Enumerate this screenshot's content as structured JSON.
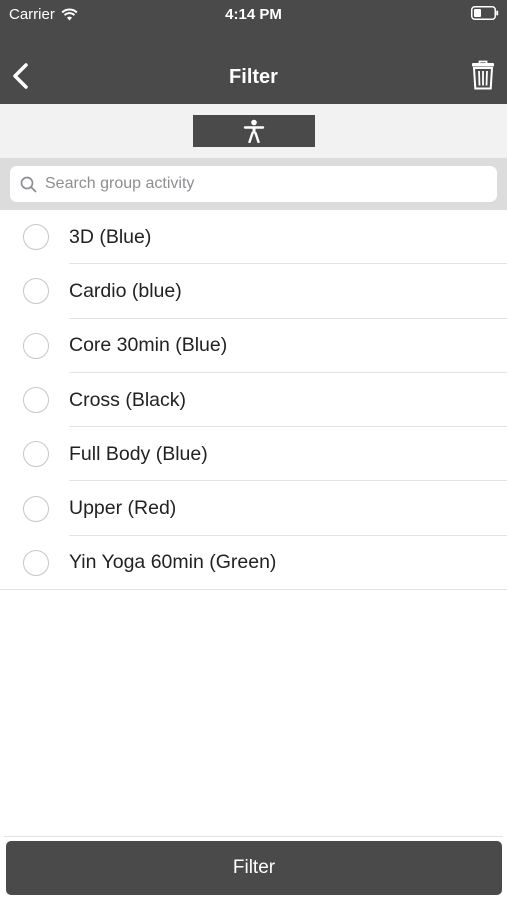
{
  "status_bar": {
    "carrier": "Carrier",
    "time": "4:14 PM",
    "wifi_icon": "wifi-icon",
    "battery_icon": "battery-icon"
  },
  "nav": {
    "title": "Filter",
    "back_icon": "chevron-left-icon",
    "trash_icon": "trash-icon"
  },
  "segment": {
    "icon": "person-icon"
  },
  "search": {
    "placeholder": "Search group activity",
    "value": "",
    "icon": "search-icon"
  },
  "activities": [
    {
      "label": "3D (Blue)",
      "selected": false
    },
    {
      "label": "Cardio (blue)",
      "selected": false
    },
    {
      "label": "Core 30min (Blue)",
      "selected": false
    },
    {
      "label": "Cross (Black)",
      "selected": false
    },
    {
      "label": "Full Body (Blue)",
      "selected": false
    },
    {
      "label": "Upper (Red)",
      "selected": false
    },
    {
      "label": "Yin Yoga 60min (Green)",
      "selected": false
    }
  ],
  "footer": {
    "filter_label": "Filter"
  },
  "colors": {
    "bar": "#4a4a4a",
    "segment_bg": "#f2f2f2",
    "search_bg": "#dcdcdc"
  }
}
